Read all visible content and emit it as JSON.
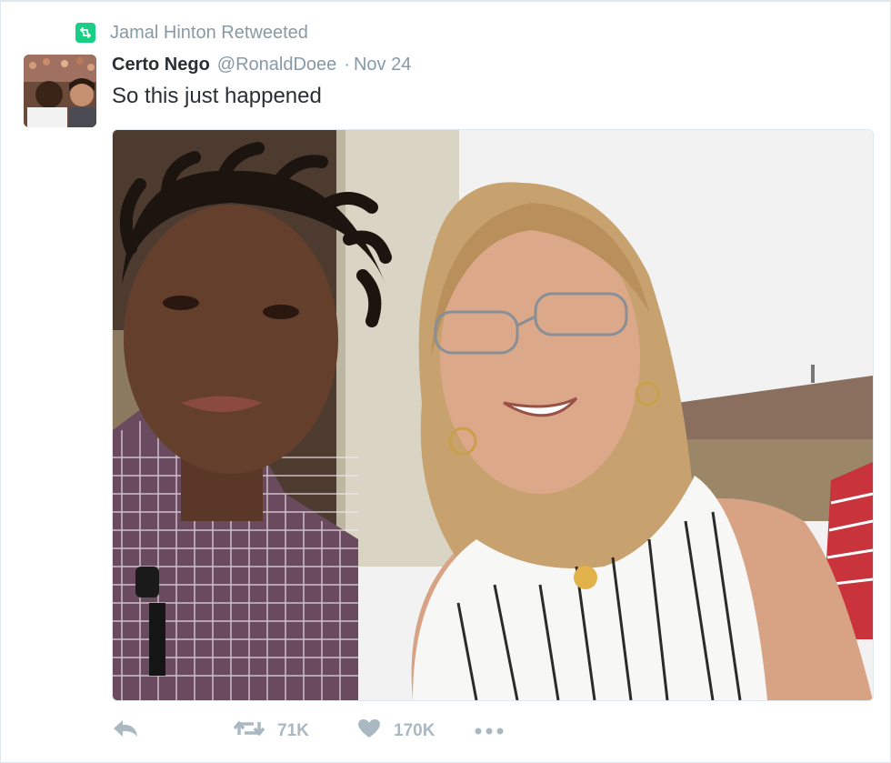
{
  "retweet_context": {
    "text": "Jamal Hinton Retweeted",
    "icon": "retweet-icon"
  },
  "tweet": {
    "display_name": "Certo Nego",
    "handle": "@RonaldDoee",
    "separator": "·",
    "date": "Nov 24",
    "text": "So this just happened"
  },
  "actions": {
    "reply_icon": "reply-icon",
    "retweet_count": "71K",
    "like_count": "170K",
    "more_icon": "more-icon"
  },
  "colors": {
    "retweet_green": "#19cf86",
    "muted": "#8899a6",
    "action_gray": "#aab8c2",
    "border": "#e1e8ed"
  }
}
